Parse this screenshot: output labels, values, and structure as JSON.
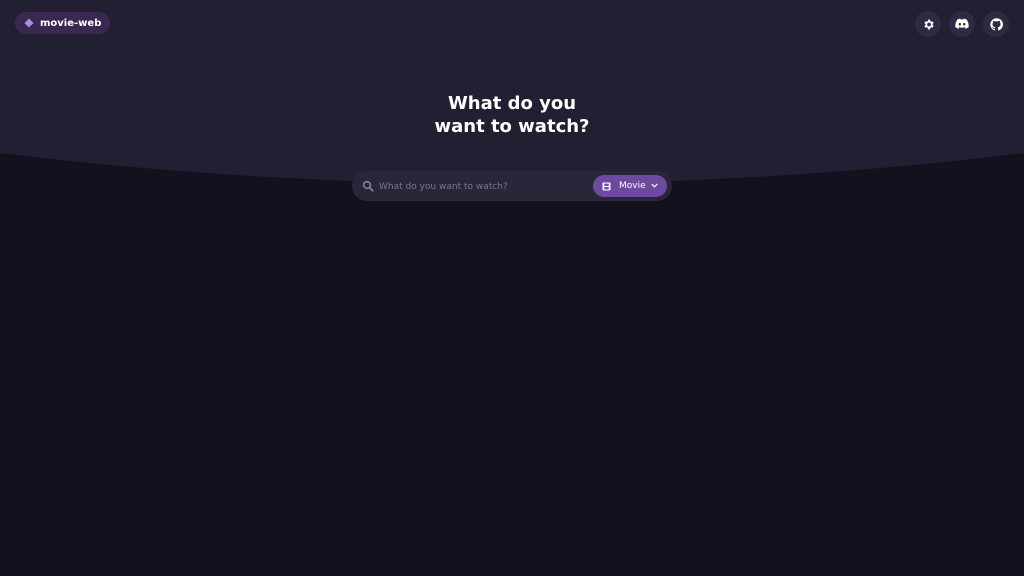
{
  "brand": {
    "name": "movie-web"
  },
  "header_actions": [
    {
      "icon": "gear-icon"
    },
    {
      "icon": "discord-icon"
    },
    {
      "icon": "github-icon"
    }
  ],
  "hero": {
    "title_line1": "What do you",
    "title_line2": "want to watch?"
  },
  "search": {
    "placeholder": "What do you want to watch?",
    "value": "",
    "type_selected": "Movie"
  },
  "colors": {
    "background": "#13111d",
    "hero": "#221f33",
    "accent": "#6d4aa0",
    "brand_pill": "#3a2850",
    "search_bg": "#2a2539"
  }
}
